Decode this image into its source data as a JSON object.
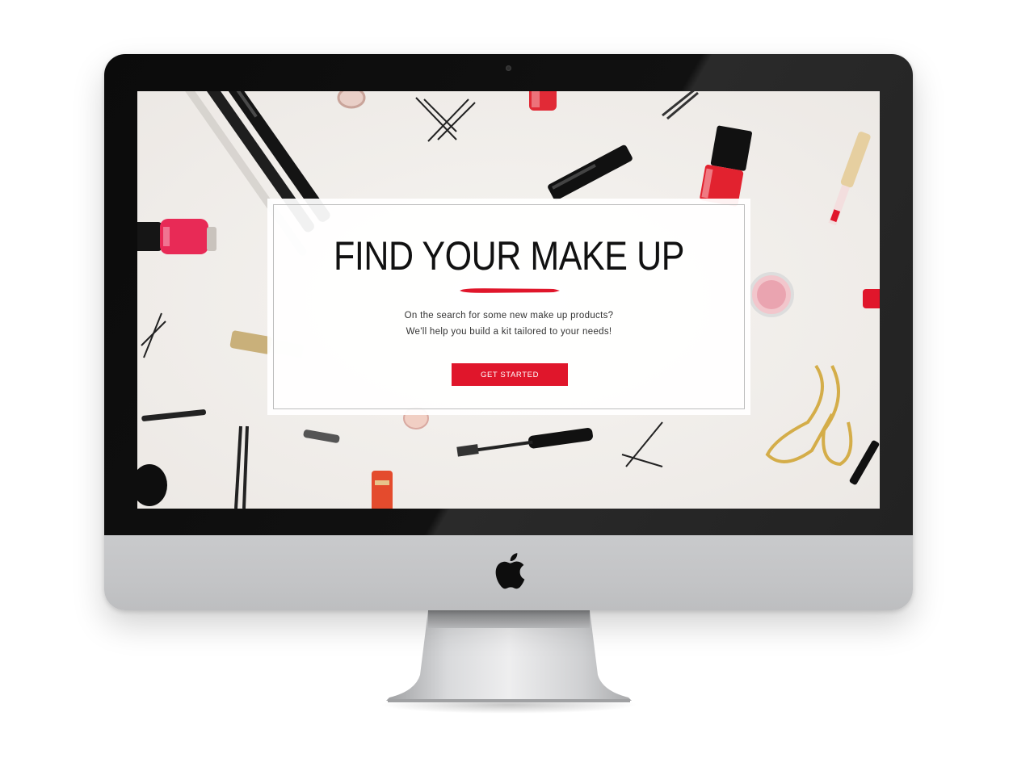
{
  "hero": {
    "title": "FIND YOUR MAKE UP",
    "line1": "On the search for some new make up products?",
    "line2": "We'll help you build a kit tailored to your needs!",
    "cta_label": "GET STARTED"
  },
  "colors": {
    "accent": "#e0162b",
    "bezel": "#0b0b0b",
    "chin": "#c4c5c7",
    "background_photo": "#f1eeeb"
  },
  "icons": {
    "brand": "apple-logo-icon",
    "camera": "camera-dot-icon"
  }
}
